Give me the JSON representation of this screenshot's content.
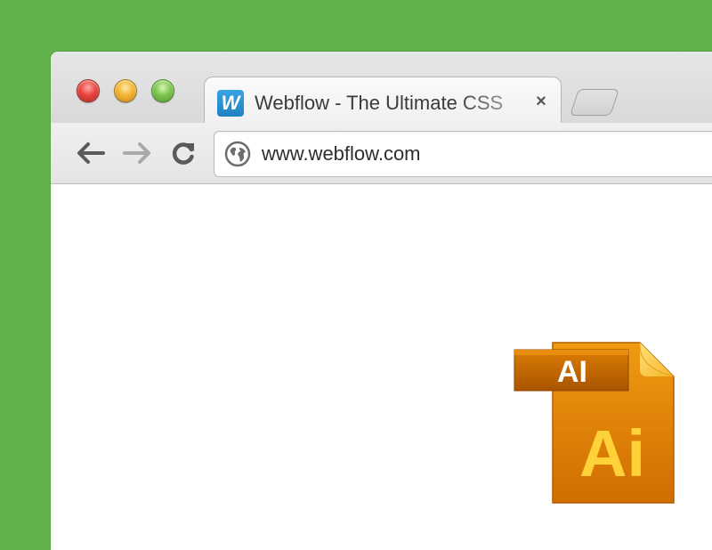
{
  "window": {
    "traffic_lights": {
      "close_color": "#e8463f",
      "minimize_color": "#f2b635",
      "zoom_color": "#7ec650"
    }
  },
  "tab": {
    "favicon_letter": "W",
    "title": "Webflow - The Ultimate CSS",
    "close_symbol": "×"
  },
  "toolbar": {
    "back_icon": "arrow-left-icon",
    "forward_icon": "arrow-right-icon",
    "reload_icon": "reload-icon"
  },
  "omnibox": {
    "url": "www.webflow.com",
    "icon": "globe-icon"
  },
  "file_icon": {
    "badge_label": "AI",
    "large_label": "Ai",
    "accent": "#e07a00"
  },
  "colors": {
    "background": "#62b24c",
    "favicon": "#1e81c2"
  }
}
